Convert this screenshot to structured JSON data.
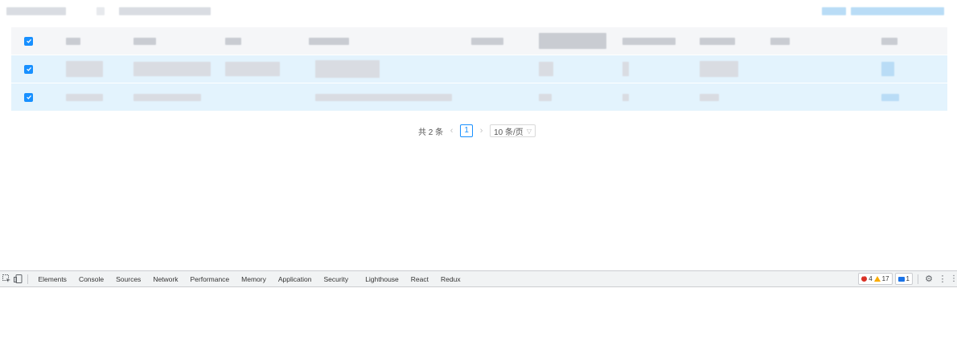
{
  "pagination": {
    "total_text": "共 2 条",
    "prev_icon": "chevron-left-icon",
    "current_page": "1",
    "next_icon": "chevron-right-icon",
    "page_size": "10 条/页",
    "page_size_icon": "chevron-down-icon"
  },
  "table": {
    "header_checkbox_checked": true,
    "rows": [
      {
        "checked": true
      },
      {
        "checked": true
      }
    ]
  },
  "devtools": {
    "left_icons": [
      "inspect-element-icon",
      "device-toolbar-icon"
    ],
    "tabs": [
      "Elements",
      "Console",
      "Sources",
      "Network",
      "Performance",
      "Memory",
      "Application",
      "Security",
      "Lighthouse",
      "React",
      "Redux"
    ],
    "errors_count": "4",
    "warnings_count": "17",
    "messages_count": "1",
    "right_icons": [
      "settings-gear-icon",
      "more-vertical-icon"
    ]
  },
  "colors": {
    "accent": "#1890ff",
    "selected_row": "#e3f3fd",
    "header_row": "#f5f6f8",
    "devtools_bg": "#f1f3f4",
    "error": "#d93025",
    "warning": "#f9ab00"
  }
}
